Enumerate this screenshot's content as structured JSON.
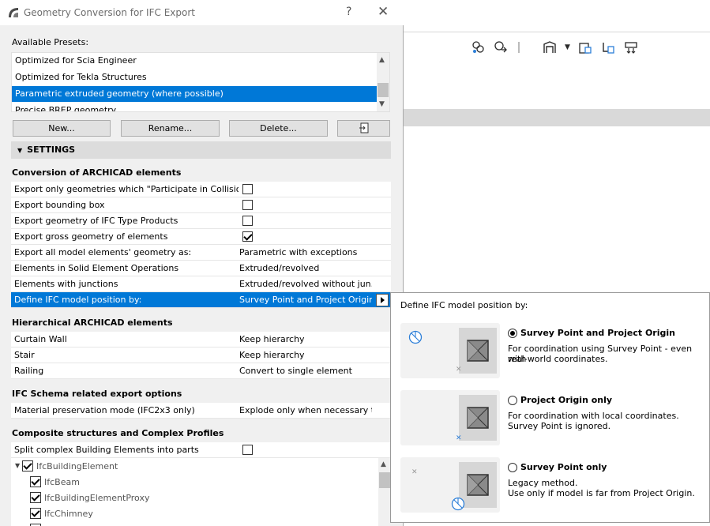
{
  "dialog": {
    "title": "Geometry Conversion for IFC Export",
    "help": "?",
    "close": "✕"
  },
  "presets": {
    "label": "Available Presets:",
    "items": [
      "Optimized for Scia Engineer",
      "Optimized for Tekla Structures",
      "Parametric extruded geometry (where possible)",
      "Precise BREP geometry"
    ],
    "selected_index": 2
  },
  "buttons": {
    "new": "New...",
    "rename": "Rename...",
    "delete": "Delete..."
  },
  "settings": {
    "header": "SETTINGS",
    "conversion": {
      "title": "Conversion of ARCHICAD elements",
      "rows": [
        {
          "label": "Export only geometries which \"Participate in Collision...",
          "checked": false
        },
        {
          "label": "Export bounding box",
          "checked": false
        },
        {
          "label": "Export geometry of IFC Type Products",
          "checked": false
        },
        {
          "label": "Export gross geometry of elements",
          "checked": true
        },
        {
          "label": "Export all model elements' geometry as:",
          "value": "Parametric with exceptions"
        },
        {
          "label": "Elements in Solid Element Operations",
          "value": "Extruded/revolved"
        },
        {
          "label": "Elements with junctions",
          "value": "Extruded/revolved without jun..."
        },
        {
          "label": "Define IFC model position by:",
          "value": "Survey Point and Project Origin"
        }
      ]
    },
    "hierarchical": {
      "title": "Hierarchical ARCHICAD elements",
      "rows": [
        {
          "label": "Curtain Wall",
          "value": "Keep hierarchy"
        },
        {
          "label": "Stair",
          "value": "Keep hierarchy"
        },
        {
          "label": "Railing",
          "value": "Convert to single element"
        }
      ]
    },
    "schema": {
      "title": "IFC Schema related export options",
      "rows": [
        {
          "label": "Material preservation mode (IFC2x3 only)",
          "value": "Explode only when necessary t..."
        }
      ]
    },
    "composite": {
      "title": "Composite structures and Complex Profiles",
      "rows": [
        {
          "label": "Split complex Building Elements into parts",
          "checked": false
        }
      ],
      "tree": [
        "IfcBuildingElement",
        "IfcBeam",
        "IfcBuildingElementProxy",
        "IfcChimney"
      ]
    }
  },
  "popup": {
    "title": "Define IFC model position by:",
    "options": [
      {
        "label": "Survey Point and Project Origin",
        "desc1": "For coordination using Survey Point - even with",
        "desc2": "real-world coordinates.",
        "selected": true
      },
      {
        "label": "Project Origin only",
        "desc1": "For coordination with local coordinates.",
        "desc2": "Survey Point is ignored.",
        "selected": false
      },
      {
        "label": "Survey Point only",
        "desc1": "Legacy method.",
        "desc2": "Use only if model is far from Project Origin.",
        "selected": false
      }
    ]
  },
  "colors": {
    "selection": "#0078d7",
    "dialog_bg": "#f0f0f0",
    "marker_blue": "#2d7fd8"
  },
  "icons": [
    "archicad-logo-icon",
    "help-icon",
    "close-icon",
    "import-preset-icon",
    "expand-arrow-icon",
    "survey-point-icon",
    "project-origin-icon",
    "model-cube-icon"
  ]
}
